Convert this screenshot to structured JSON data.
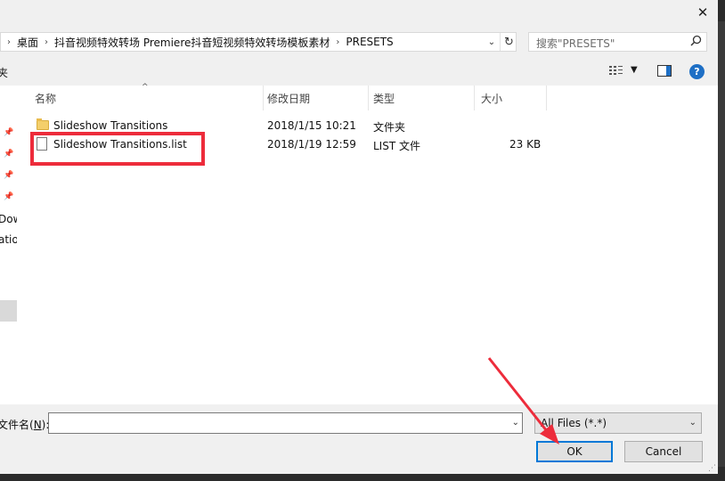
{
  "window": {
    "close_glyph": "✕"
  },
  "address": {
    "crumbs": [
      "桌面",
      "抖音视频特效转场 Premiere抖音短视频特效转场模板素材",
      "PRESETS"
    ],
    "separator": "›",
    "dropdown_glyph": "⌄",
    "refresh_glyph": "↻"
  },
  "search": {
    "placeholder": "搜索\"PRESETS\"",
    "icon": "search-icon"
  },
  "toolbar": {
    "left_label": "夹",
    "view_icon": "view-details-icon",
    "preview_icon": "preview-pane-icon",
    "help_label": "?"
  },
  "nav": {
    "items": [
      "Dow",
      "atio"
    ]
  },
  "columns": {
    "name": "名称",
    "modified": "修改日期",
    "type": "类型",
    "size": "大小"
  },
  "files": [
    {
      "name": "Slideshow Transitions",
      "modified": "2018/1/15 10:21",
      "type": "文件夹",
      "size": "",
      "icon": "folder-icon"
    },
    {
      "name": "Slideshow Transitions.list",
      "modified": "2018/1/19 12:59",
      "type": "LIST 文件",
      "size": "23 KB",
      "icon": "file-icon"
    }
  ],
  "filename": {
    "label_prefix": "文件名(",
    "label_key": "N",
    "label_suffix": "):",
    "value": ""
  },
  "filter": {
    "value": "All Files (*.*)"
  },
  "buttons": {
    "ok": "OK",
    "cancel": "Cancel"
  },
  "annotation": {
    "highlight_color": "#ed2c3b",
    "arrow_color": "#ed2c3b"
  },
  "colors": {
    "accent": "#0078d7"
  }
}
